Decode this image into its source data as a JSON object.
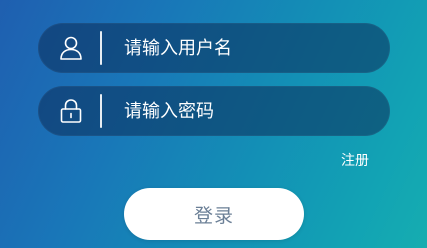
{
  "form": {
    "username": {
      "icon": "user-icon",
      "placeholder": "请输入用户名",
      "value": ""
    },
    "password": {
      "icon": "lock-icon",
      "placeholder": "请输入密码",
      "value": ""
    },
    "register_label": "注册",
    "login_label": "登录"
  },
  "colors": {
    "background_start": "#1f5fb0",
    "background_end": "#16adb0",
    "field_background": "#0b2d5a",
    "login_button_bg": "#ffffff",
    "login_button_text": "#6b7f96"
  }
}
